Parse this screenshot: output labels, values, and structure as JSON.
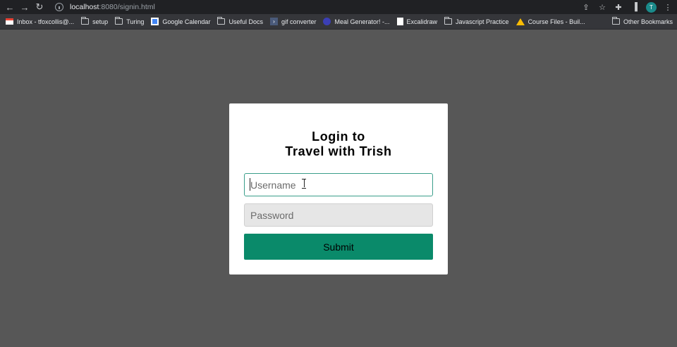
{
  "browser": {
    "url_host": "localhost",
    "url_path": ":8080/signin.html",
    "avatar_initial": "T",
    "nav": {
      "back": "←",
      "forward": "→",
      "reload": "↻"
    },
    "actions": {
      "share": "⇪",
      "bookmark_star": "☆",
      "extensions": "✚",
      "sidebar": "▐",
      "menu": "⋮"
    }
  },
  "bookmarks": {
    "items": [
      {
        "label": "Inbox - tfoxcollis@...",
        "icon": "gmail-icon"
      },
      {
        "label": "setup",
        "icon": "folder-icon"
      },
      {
        "label": "Turing",
        "icon": "folder-icon"
      },
      {
        "label": "Google Calendar",
        "icon": "google-calendar-icon"
      },
      {
        "label": "Useful Docs",
        "icon": "folder-icon"
      },
      {
        "label": "gif converter",
        "icon": "gif-converter-icon",
        "glyph": "›"
      },
      {
        "label": "Meal Generator! -...",
        "icon": "meal-generator-icon"
      },
      {
        "label": "Excalidraw",
        "icon": "excalidraw-icon"
      },
      {
        "label": "Javascript Practice",
        "icon": "folder-icon"
      },
      {
        "label": "Course Files - Buil...",
        "icon": "google-drive-icon"
      }
    ],
    "other": "Other Bookmarks"
  },
  "login": {
    "title_line1": "Login to",
    "title_line2": "Travel with Trish",
    "username_placeholder": "Username",
    "password_placeholder": "Password",
    "submit_label": "Submit"
  },
  "colors": {
    "page_background": "#575757",
    "submit_button": "#0a8a6a",
    "focus_border": "#3a9e8a",
    "avatar": "#1a8a8a"
  }
}
